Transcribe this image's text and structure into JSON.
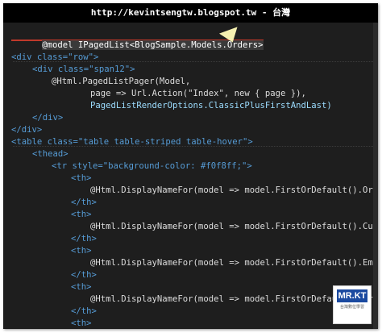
{
  "banner": {
    "text": "http://kevintsengtw.blogspot.tw - 台灣"
  },
  "logo": {
    "text": "MR.KT",
    "sub": "台灣數位學習"
  },
  "code": {
    "l1": "@model IPagedList<BlogSample.Models.Orders>",
    "l2": "<div class=\"row\">",
    "l3": "<div class=\"span12\">",
    "l4": "@Html.PagedListPager(Model,",
    "l5": "page => Url.Action(\"Index\", new { page }),",
    "l6": "PagedListRenderOptions.ClassicPlusFirstAndLast)",
    "l7": "</div>",
    "l8": "</div>",
    "l9": "<table class=\"table table-striped table-hover\">",
    "l10": "<thead>",
    "l11": "<tr style=\"background-color: #f0f8ff;\">",
    "l12": "<th>",
    "l13": "@Html.DisplayNameFor(model => model.FirstOrDefault().OrderID)",
    "l14": "</th>",
    "l15": "<th>",
    "l16": "@Html.DisplayNameFor(model => model.FirstOrDefault().CustomerI",
    "l17": "</th>",
    "l18": "<th>",
    "l19": "@Html.DisplayNameFor(model => model.FirstOrDefault().Employeel",
    "l20": "</th>",
    "l21": "<th>",
    "l22": "@Html.DisplayNameFor(model => model.FirstOrDefault().OrderDate",
    "l23": "</th>",
    "l24": "<th>"
  }
}
